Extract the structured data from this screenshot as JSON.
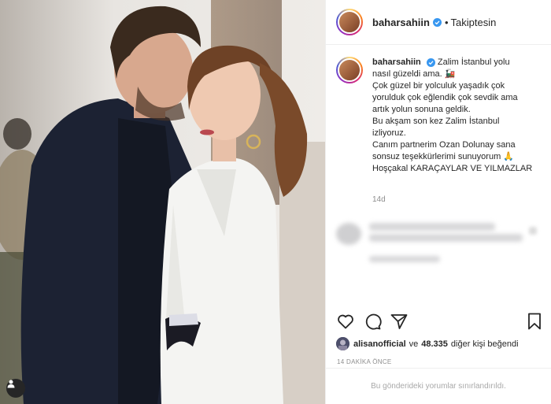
{
  "post": {
    "username": "baharsahiin",
    "follow_status": "Takiptesin",
    "separator": "•",
    "caption_lines": [
      "Zalim İstanbul yolu",
      "nasıl güzeldi ama. 🚂",
      "Çok güzel bir yolculuk yaşadık çok",
      "yorulduk çok eğlendik çok sevdik ama",
      "artık yolun sonuna geldik.",
      "Bu akşam son kez Zalim İstanbul",
      "izliyoruz.",
      "Canım partnerim Ozan Dolunay sana",
      "sonsuz teşekkürlerimi sunuyorum 🙏",
      "Hoşçakal KARAÇAYLAR VE YILMAZLAR"
    ],
    "time_ago": "14d",
    "liked_by_user": "alisanofficial",
    "likes_connector": "ve",
    "likes_count": "48.335",
    "likes_suffix": "diğer kişi beğendi",
    "date_label": "14 DAKİKA ÖNCE",
    "comments_disabled_text": "Bu gönderideki yorumlar sınırlandırıldı."
  },
  "icons": {
    "verified": "verified-badge-icon",
    "like": "heart-icon",
    "comment": "comment-icon",
    "share": "share-icon",
    "save": "bookmark-icon",
    "tagged_user": "user-icon"
  },
  "colors": {
    "verified": "#3897f0",
    "muted_text": "#8e8e8e",
    "border": "#efefef"
  }
}
